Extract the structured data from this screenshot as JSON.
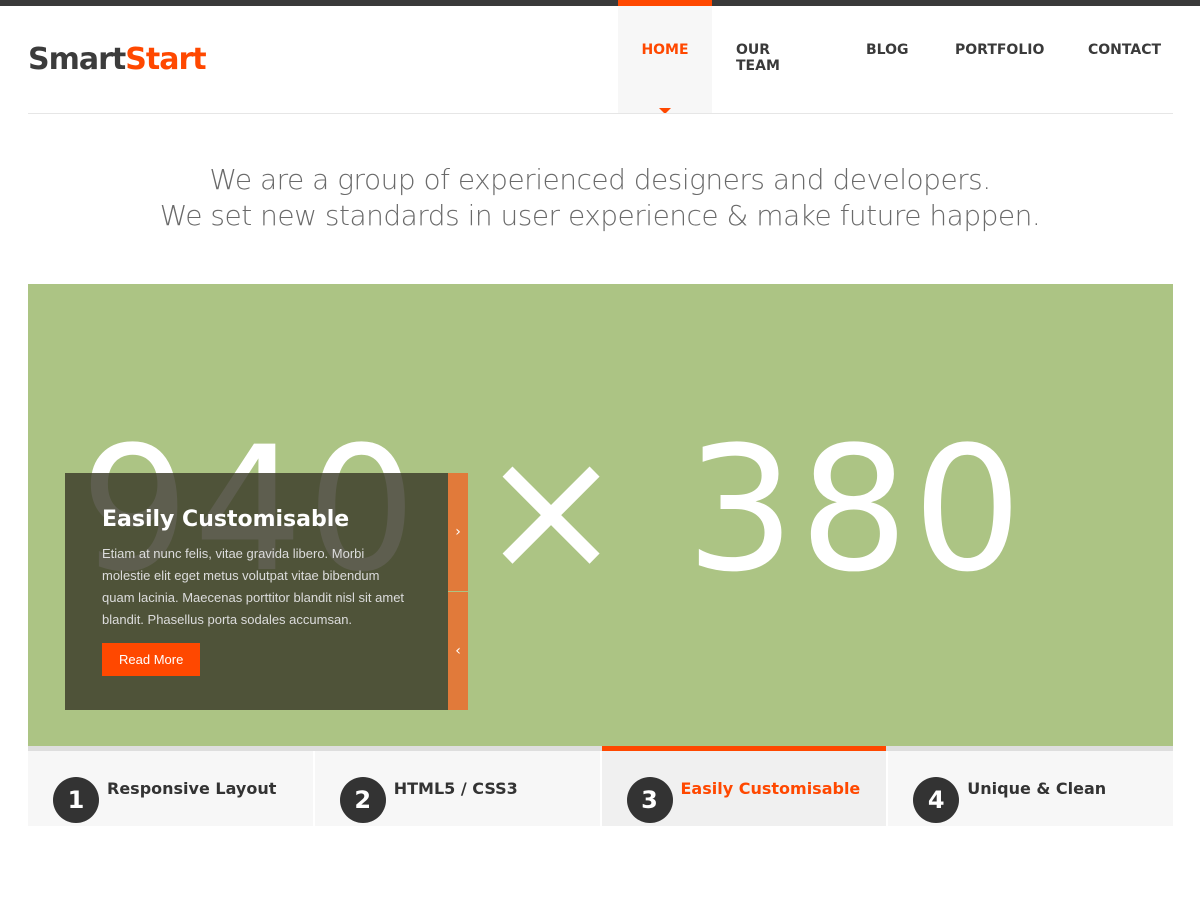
{
  "brand": {
    "smart": "Smart",
    "start": "Start",
    "accent_color": "#ff4800"
  },
  "nav": {
    "items": [
      {
        "label": "HOME",
        "active": true
      },
      {
        "label": "OUR TEAM"
      },
      {
        "label": "BLOG"
      },
      {
        "label": "PORTFOLIO"
      },
      {
        "label": "CONTACT"
      }
    ]
  },
  "tagline": {
    "line1": "We are a group of experienced designers and developers.",
    "line2": "We set new standards in user experience & make future happen."
  },
  "slider": {
    "placeholder_text": "940 × 380",
    "background_color": "#acc484",
    "caption": {
      "title": "Easily Customisable",
      "text": "Etiam at nunc felis, vitae gravida libero. Morbi molestie elit eget metus volutpat vitae bibendum quam lacinia. Maecenas porttitor blandit nisl sit amet blandit. Phasellus porta sodales accumsan.",
      "button": "Read More"
    },
    "next_glyph": "›",
    "prev_glyph": "‹"
  },
  "tabs": [
    {
      "num": "1",
      "label": "Responsive Layout"
    },
    {
      "num": "2",
      "label": "HTML5 / CSS3"
    },
    {
      "num": "3",
      "label": "Easily Customisable",
      "active": true
    },
    {
      "num": "4",
      "label": "Unique & Clean"
    }
  ]
}
